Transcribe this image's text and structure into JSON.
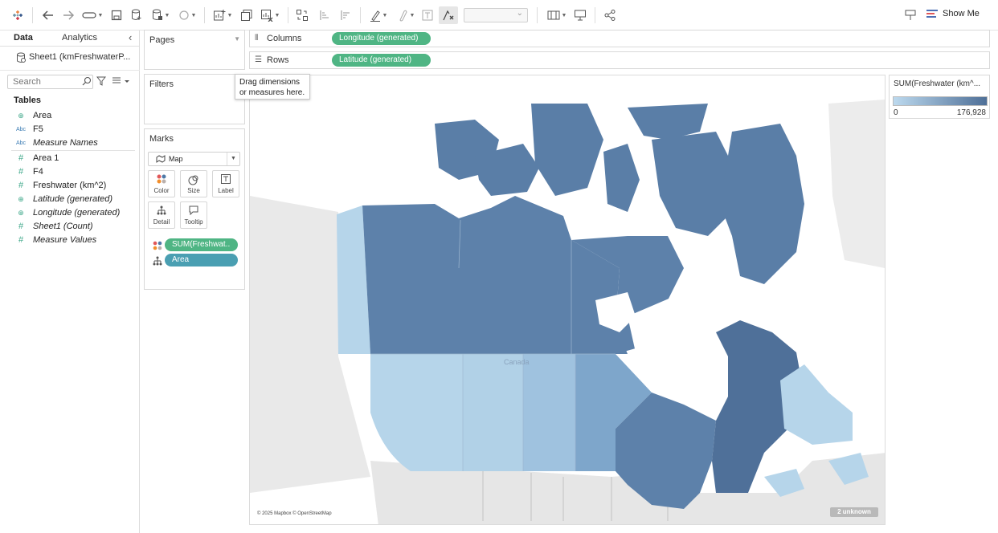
{
  "toolbar": {
    "show_me_label": "Show Me",
    "icons": [
      "tableau-logo-icon",
      "undo-icon",
      "redo-icon",
      "replay-icon",
      "save-icon",
      "new-datasource-icon",
      "pause-update-icon",
      "refresh-icon",
      "new-worksheet-icon",
      "duplicate-sheet-icon",
      "clear-sheet-icon",
      "swap-icon",
      "sort-ascending-icon",
      "sort-descending-icon",
      "highlight-icon",
      "group-icon",
      "show-labels-icon",
      "fix-axes-icon",
      "fit-select",
      "show-cards-icon",
      "presentation-icon",
      "share-icon",
      "pin-icon",
      "show-me-icon"
    ]
  },
  "data_pane": {
    "tabs": [
      "Data",
      "Analytics"
    ],
    "datasource": "Sheet1 (kmFreshwaterP...",
    "search_placeholder": "Search",
    "tables_label": "Tables",
    "fields": [
      {
        "icon": "globe",
        "label": "Area",
        "italic": false
      },
      {
        "icon": "abc",
        "label": "F5",
        "italic": false
      },
      {
        "icon": "abc",
        "label": "Measure Names",
        "italic": true
      },
      {
        "icon": "hash",
        "label": "Area 1",
        "italic": false
      },
      {
        "icon": "hash",
        "label": "F4",
        "italic": false
      },
      {
        "icon": "hash",
        "label": "Freshwater (km^2)",
        "italic": false
      },
      {
        "icon": "globe",
        "label": "Latitude (generated)",
        "italic": true
      },
      {
        "icon": "globe",
        "label": "Longitude (generated)",
        "italic": true
      },
      {
        "icon": "hash",
        "label": "Sheet1 (Count)",
        "italic": true
      },
      {
        "icon": "hash",
        "label": "Measure Values",
        "italic": true
      }
    ]
  },
  "cards": {
    "pages": "Pages",
    "filters": "Filters",
    "marks": "Marks",
    "mark_type": "Map",
    "mark_buttons": [
      "Color",
      "Size",
      "Label",
      "Detail",
      "Tooltip"
    ],
    "mark_pills": [
      "SUM(Freshwat..",
      "Area"
    ]
  },
  "shelves": {
    "columns_label": "Columns",
    "rows_label": "Rows",
    "columns_pill": "Longitude (generated)",
    "rows_pill": "Latitude (generated)"
  },
  "drag_tip": "Drag dimensions or measures here.",
  "map": {
    "country_label": "Canada",
    "attribution": "© 2025 Mapbox © OpenStreetMap",
    "unknown_badge": "2 unknown",
    "colors": {
      "dark": "#5a7ea7",
      "mid": "#7ea6cb",
      "light": "#b6d5ea",
      "land": "#e9e9e9",
      "water": "#ffffff"
    }
  },
  "legend": {
    "title": "SUM(Freshwater (km^...",
    "min": "0",
    "max": "176,928",
    "color_low": "#bcd9ee",
    "color_high": "#4e6f97"
  }
}
